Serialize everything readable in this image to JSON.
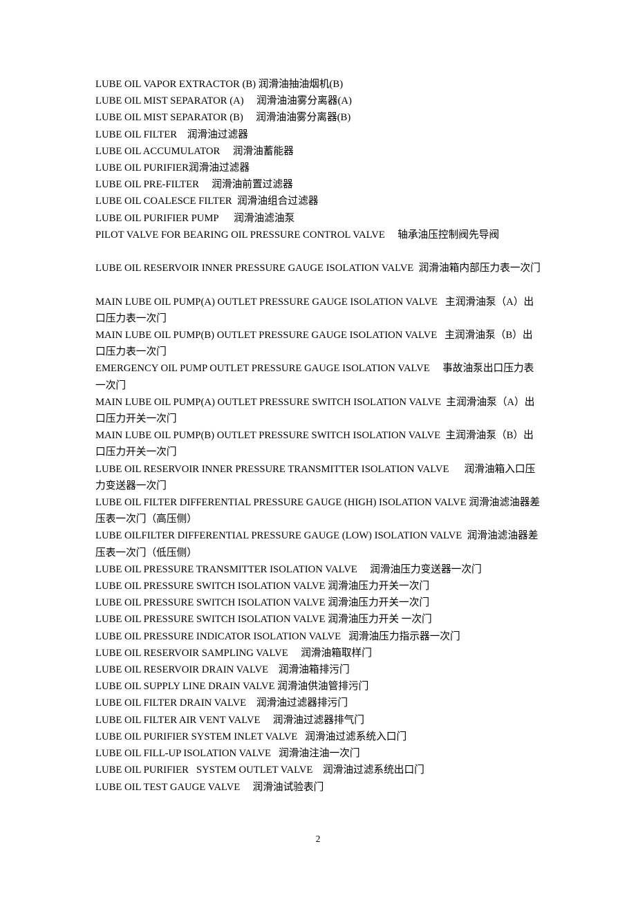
{
  "document": {
    "page_number": "2",
    "lines": [
      {
        "id": "lube-oil-vapor-extractor-b",
        "text": "LUBE OIL VAPOR EXTRACTOR (B) 润滑油抽油烟机(B)"
      },
      {
        "id": "lube-oil-mist-separator-a",
        "text": "LUBE OIL MIST SEPARATOR (A)     润滑油油雾分离器(A)"
      },
      {
        "id": "lube-oil-mist-separator-b",
        "text": "LUBE OIL MIST SEPARATOR (B)     润滑油油雾分离器(B)"
      },
      {
        "id": "lube-oil-filter",
        "text": "LUBE OIL FILTER    润滑油过滤器"
      },
      {
        "id": "lube-oil-accumulator",
        "text": "LUBE OIL ACCUMULATOR     润滑油蓄能器"
      },
      {
        "id": "lube-oil-purifier",
        "text": "LUBE OIL PURIFIER润滑油过滤器"
      },
      {
        "id": "lube-oil-pre-filter",
        "text": "LUBE OIL PRE-FILTER     润滑油前置过滤器"
      },
      {
        "id": "lube-oil-coalesce-filter",
        "text": "LUBE OIL COALESCE FILTER  润滑油组合过滤器"
      },
      {
        "id": "lube-oil-purifier-pump",
        "text": "LUBE OIL PURIFIER PUMP      润滑油滤油泵"
      },
      {
        "id": "pilot-valve-bearing-oil-pressure-control-valve",
        "text": "PILOT VALVE FOR BEARING OIL PRESSURE CONTROL VALVE     轴承油压控制阀先导阀"
      },
      {
        "id": "spacer-1",
        "text": "",
        "spacer": true
      },
      {
        "id": "lube-oil-reservoir-inner-pressure-gauge-isolation-valve",
        "text": "LUBE OIL RESERVOIR INNER PRESSURE GAUGE ISOLATION VALVE  润滑油箱内部压力表一次门"
      },
      {
        "id": "spacer-2",
        "text": "",
        "spacer": true
      },
      {
        "id": "main-lube-oil-pump-a-outlet-pressure-gauge-isolation-valve",
        "text": "MAIN LUBE OIL PUMP(A) OUTLET PRESSURE GAUGE ISOLATION VALVE   主润滑油泵（A）出口压力表一次门"
      },
      {
        "id": "main-lube-oil-pump-b-outlet-pressure-gauge-isolation-valve",
        "text": "MAIN LUBE OIL PUMP(B) OUTLET PRESSURE GAUGE ISOLATION VALVE   主润滑油泵（B）出口压力表一次门"
      },
      {
        "id": "emergency-oil-pump-outlet-pressure-gauge-isolation-valve",
        "text": "EMERGENCY OIL PUMP OUTLET PRESSURE GAUGE ISOLATION VALVE     事故油泵出口压力表一次门"
      },
      {
        "id": "main-lube-oil-pump-a-outlet-pressure-switch-isolation-valve",
        "text": "MAIN LUBE OIL PUMP(A) OUTLET PRESSURE SWITCH ISOLATION VALVE  主润滑油泵（A）出口压力开关一次门"
      },
      {
        "id": "main-lube-oil-pump-b-outlet-pressure-switch-isolation-valve",
        "text": "MAIN LUBE OIL PUMP(B) OUTLET PRESSURE SWITCH ISOLATION VALVE  主润滑油泵（B）出口压力开关一次门"
      },
      {
        "id": "lube-oil-reservoir-inner-pressure-transmitter-isolation-valve",
        "text": "LUBE OIL RESERVOIR INNER PRESSURE TRANSMITTER ISOLATION VALVE      润滑油箱入口压力变送器一次门"
      },
      {
        "id": "lube-oil-filter-differential-pressure-gauge-high-isolation-valve",
        "text": "LUBE OIL FILTER DIFFERENTIAL PRESSURE GAUGE (HIGH) ISOLATION VALVE 润滑油滤油器差压表一次门（高压侧）"
      },
      {
        "id": "lube-oil-filter-differential-pressure-gauge-low-isolation-valve",
        "text": "LUBE OILFILTER DIFFERENTIAL PRESSURE GAUGE (LOW) ISOLATION VALVE  润滑油滤油器差压表一次门（低压侧）"
      },
      {
        "id": "lube-oil-pressure-transmitter-isolation-valve",
        "text": "LUBE OIL PRESSURE TRANSMITTER ISOLATION VALVE     润滑油压力变送器一次门"
      },
      {
        "id": "lube-oil-pressure-switch-isolation-valve-1",
        "text": "LUBE OIL PRESSURE SWITCH ISOLATION VALVE 润滑油压力开关一次门"
      },
      {
        "id": "lube-oil-pressure-switch-isolation-valve-2",
        "text": "LUBE OIL PRESSURE SWITCH ISOLATION VALVE 润滑油压力开关一次门"
      },
      {
        "id": "lube-oil-pressure-switch-isolation-valve-3",
        "text": "LUBE OIL PRESSURE SWITCH ISOLATION VALVE 润滑油压力开关 一次门"
      },
      {
        "id": "lube-oil-pressure-indicator-isolation-valve",
        "text": "LUBE OIL PRESSURE INDICATOR ISOLATION VALVE   润滑油压力指示器一次门"
      },
      {
        "id": "lube-oil-reservoir-sampling-valve",
        "text": "LUBE OIL RESERVOIR SAMPLING VALVE     润滑油箱取样门"
      },
      {
        "id": "lube-oil-reservoir-drain-valve",
        "text": "LUBE OIL RESERVOIR DRAIN VALVE    润滑油箱排污门"
      },
      {
        "id": "lube-oil-supply-line-drain-valve",
        "text": "LUBE OIL SUPPLY LINE DRAIN VALVE 润滑油供油管排污门"
      },
      {
        "id": "lube-oil-filter-drain-valve",
        "text": "LUBE OIL FILTER DRAIN VALVE    润滑油过滤器排污门"
      },
      {
        "id": "lube-oil-filter-air-vent-valve",
        "text": "LUBE OIL FILTER AIR VENT VALVE     润滑油过滤器排气门"
      },
      {
        "id": "lube-oil-purifier-system-inlet-valve",
        "text": "LUBE OIL PURIFIER SYSTEM INLET VALVE   润滑油过滤系统入口门"
      },
      {
        "id": "lube-oil-fill-up-isolation-valve",
        "text": "LUBE OIL FILL-UP ISOLATION VALVE   润滑油注油一次门"
      },
      {
        "id": "lube-oil-purifier-system-outlet-valve",
        "text": "LUBE OIL PURIFIER   SYSTEM OUTLET VALVE    润滑油过滤系统出口门"
      },
      {
        "id": "lube-oil-test-gauge-valve",
        "text": "LUBE OIL TEST GAUGE VALVE     润滑油试验表门"
      }
    ]
  }
}
